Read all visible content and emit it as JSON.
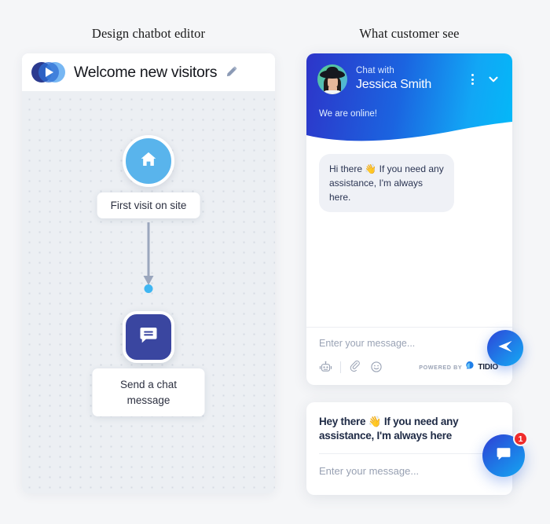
{
  "headings": {
    "left": "Design chatbot editor",
    "right": "What customer see"
  },
  "editor": {
    "logo_icon": "tidio-play-logo-icon",
    "title": "Welcome new visitors",
    "edit_icon": "pencil-icon",
    "flow": {
      "trigger": {
        "icon": "home-icon",
        "label": "First visit on site",
        "node_color": "#59b4ec"
      },
      "connector": {
        "arrow_icon": "arrow-down-icon",
        "dot_color": "#3fb6f2"
      },
      "action": {
        "icon": "chat-bubble-icon",
        "label": "Send a chat message",
        "node_color": "#3a46a0"
      }
    }
  },
  "widget": {
    "header": {
      "avatar": "agent-avatar",
      "chat_with_label": "Chat with",
      "agent_name": "Jessica Smith",
      "menu_icon": "kebab-menu-icon",
      "collapse_icon": "chevron-down-icon",
      "status": "We are online!",
      "gradient_from": "#2d35c9",
      "gradient_to": "#03b9f8"
    },
    "messages": [
      {
        "author": "bot",
        "text": "Hi there 👋 If you need any assistance, I'm always here."
      }
    ],
    "composer": {
      "placeholder": "Enter your message...",
      "bot_icon": "robot-icon",
      "attach_icon": "paperclip-icon",
      "emoji_icon": "emoji-smiley-icon",
      "powered_by_label": "POWERED BY",
      "powered_by_brand": "TIDIO",
      "brand_icon": "tidio-bubble-icon",
      "send_icon": "send-paper-plane-icon"
    }
  },
  "teaser": {
    "message": "Hey there 👋 If you need any assistance, I'm always here",
    "placeholder": "Enter your message...",
    "launcher_icon": "chat-bubble-icon",
    "badge_count": "1",
    "badge_color": "#f02b2b"
  }
}
